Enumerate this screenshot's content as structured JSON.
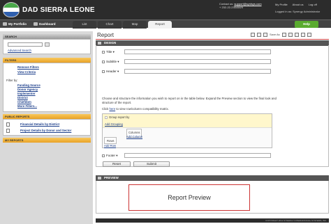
{
  "header": {
    "brand": "DAD SIERRA LEONE",
    "contact_label": "Contact us:",
    "contact_email": "support@synisys.com",
    "contact_phone": "+ 232-22-235458/9",
    "top_links": [
      "My Profile",
      "About us",
      "Log off"
    ],
    "logged_in": "Logged in as: Synergy Administrator"
  },
  "nav": {
    "my_portfolio": "My Portfolio",
    "dashboard": "Dashboard",
    "tabs": [
      "List",
      "Chart",
      "Map",
      "Report"
    ],
    "active_tab": "Report",
    "help": "Help"
  },
  "sidebar": {
    "search": {
      "heading": "SEARCH",
      "advanced": "Advanced Search"
    },
    "filters": {
      "heading": "FILTERS",
      "remove": "Remove Filters",
      "view_criteria": "View Criteria",
      "filter_by": "Filter by:",
      "items": [
        "Funding Source",
        "Donor Agency",
        "Implementer",
        "District",
        "Chiefdom",
        "More Filters..."
      ]
    },
    "public_reports": {
      "heading": "PUBLIC REPORTS",
      "items": [
        "Financial Details by District",
        "Project Details by Donor and Sector"
      ]
    },
    "my_reports": {
      "heading": "MY REPORTS"
    }
  },
  "main": {
    "title": "Report",
    "toolbar": {
      "save_as": "Save As"
    },
    "design_heading": "DESIGN",
    "fields": {
      "title_label": "Title",
      "subtitle_label": "Subtitle",
      "header_label": "Header",
      "footer_label": "Footer",
      "title_value": "",
      "subtitle_value": "",
      "header_value": "",
      "footer_value": ""
    },
    "instructions": "Choose and structure the information you wish to report on in the table below. Expand the Preview section to view the final look and structure of the report.",
    "matrix_prefix": "Click",
    "matrix_link": "here",
    "matrix_suffix": "to view row/column compatibility matrix.",
    "grid": {
      "group_report_by": "Group report by",
      "add_grouping": "Add Grouping",
      "rows": "Rows",
      "columns": "Columns",
      "add_column": "Add Column",
      "add_row": "Add Row"
    },
    "reset": "Reset",
    "submit": "Submit",
    "preview_heading": "PREVIEW",
    "preview_text": "Report Preview"
  },
  "footer": {
    "copyright": "COPYRIGHT 2011 SYNERGY INTERNATIONAL SYSTEMS, INC."
  },
  "colors": {
    "accent_orange": "#e9a227",
    "help_green": "#5aab2f",
    "link_blue": "#1a3d8a",
    "header_dark": "#2c2c2c"
  }
}
